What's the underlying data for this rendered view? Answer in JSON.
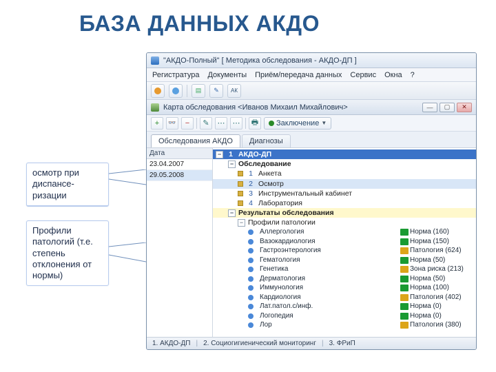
{
  "slide": {
    "title": "БАЗА ДАННЫХ АКДО"
  },
  "annotations": {
    "a1": "осмотр при диспансе-ризации",
    "a2": "Профили патологий (т.е. степень отклонения от нормы)"
  },
  "app": {
    "title": "\"АКДО-Полный\"  [ Методика обследования - АКДО-ДП ]",
    "menu": {
      "m1": "Регистратура",
      "m2": "Документы",
      "m3": "Приём/передача данных",
      "m4": "Сервис",
      "m5": "Окна",
      "m6": "?"
    },
    "subwin": {
      "title": "Карта обследования <Иванов Михаил Михайлович>",
      "concl": "Заключение"
    },
    "tabs": {
      "t1": "Обследования АКДО",
      "t2": "Диагнозы"
    },
    "datecol": {
      "hd": "Дата",
      "d1": "23.04.2007",
      "d2": "29.05.2008"
    },
    "tree": {
      "root": "АКДО-ДП",
      "root_num": "1",
      "sec1": "Обследование",
      "i1_num": "1",
      "i1": "Анкета",
      "i2_num": "2",
      "i2": "Осмотр",
      "i3_num": "3",
      "i3": "Инструментальный кабинет",
      "i4_num": "4",
      "i4": "Лаборатория",
      "sec2": "Результаты обследования",
      "sub1": "Профили патологии"
    },
    "pathologies": [
      {
        "name": "Аллергология",
        "mark": "green",
        "val": "Норма (160)"
      },
      {
        "name": "Вазокардиология",
        "mark": "green",
        "val": "Норма (150)"
      },
      {
        "name": "Гастроэнтерология",
        "mark": "yellow",
        "val": "Патология (624)"
      },
      {
        "name": "Гематология",
        "mark": "green",
        "val": "Норма (50)"
      },
      {
        "name": "Генетика",
        "mark": "yellow",
        "val": "Зона риска (213)"
      },
      {
        "name": "Дерматология",
        "mark": "green",
        "val": "Норма (50)"
      },
      {
        "name": "Иммунология",
        "mark": "green",
        "val": "Норма (100)"
      },
      {
        "name": "Кардиология",
        "mark": "yellow",
        "val": "Патология (402)"
      },
      {
        "name": "Лат.патол.с/инф.",
        "mark": "green",
        "val": "Норма (0)"
      },
      {
        "name": "Логопедия",
        "mark": "green",
        "val": "Норма (0)"
      },
      {
        "name": "Лор",
        "mark": "yellow",
        "val": "Патология (380)"
      }
    ],
    "status": {
      "s1": "1. АКДО-ДП",
      "s2": "2. Социогигиенический мониторинг",
      "s3": "3. ФРиП"
    }
  }
}
